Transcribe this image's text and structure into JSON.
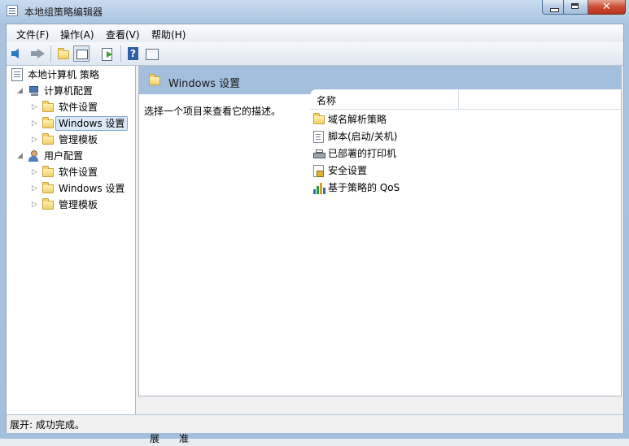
{
  "window": {
    "title": "本地组策略编辑器"
  },
  "menu": [
    "文件(F)",
    "操作(A)",
    "查看(V)",
    "帮助(H)"
  ],
  "toolbar": {
    "buttons": [
      "back-icon",
      "forward-icon",
      "up-folder-icon",
      "show-tree-icon",
      "export-icon",
      "help-icon",
      "properties-icon"
    ]
  },
  "tree": {
    "root": "本地计算机 策略",
    "computer": {
      "label": "计算机配置",
      "children": [
        "软件设置",
        "Windows 设置",
        "管理模板"
      ]
    },
    "user": {
      "label": "用户配置",
      "children": [
        "软件设置",
        "Windows 设置",
        "管理模板"
      ]
    }
  },
  "main": {
    "header": "Windows 设置",
    "description": "选择一个项目来查看它的描述。",
    "column_name": "名称",
    "items": [
      "域名解析策略",
      "脚本(启动/关机)",
      "已部署的打印机",
      "安全设置",
      "基于策略的 QoS"
    ],
    "tabs": [
      "扩展",
      "标准"
    ]
  },
  "status": "展开: 成功完成。"
}
